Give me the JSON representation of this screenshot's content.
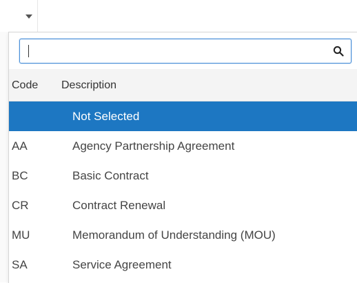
{
  "dropdown": {
    "toggle_icon": "caret-down-icon"
  },
  "search": {
    "value": "",
    "placeholder": "",
    "icon": "search-icon"
  },
  "table": {
    "headers": {
      "code": "Code",
      "description": "Description"
    },
    "rows": [
      {
        "code": "",
        "description": "Not Selected",
        "selected": true
      },
      {
        "code": "AA",
        "description": "Agency Partnership Agreement"
      },
      {
        "code": "BC",
        "description": "Basic Contract"
      },
      {
        "code": "CR",
        "description": "Contract Renewal"
      },
      {
        "code": "MU",
        "description": "Memorandum of Understanding (MOU)"
      },
      {
        "code": "SA",
        "description": "Service Agreement"
      }
    ]
  },
  "colors": {
    "selected_row": "#1d77c2",
    "header_bg": "#f4f4f4",
    "focus_border": "#4a90d9"
  }
}
